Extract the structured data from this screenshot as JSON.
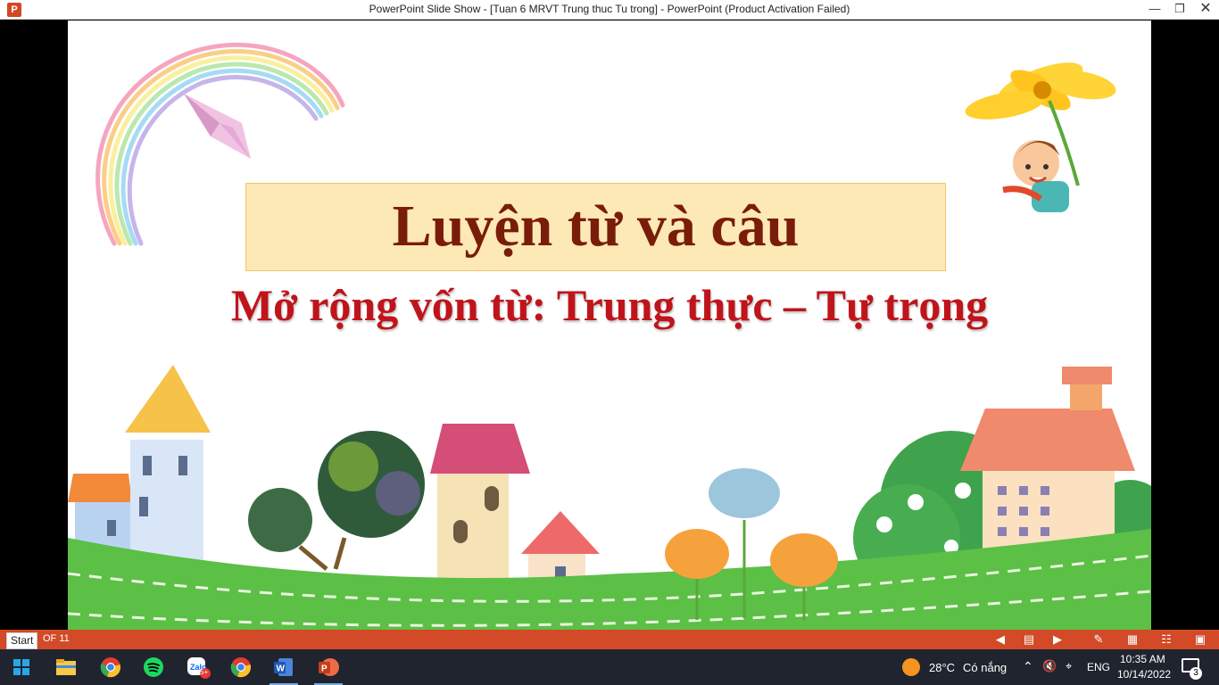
{
  "window": {
    "title": "PowerPoint Slide Show - [Tuan 6 MRVT Trung thuc  Tu trong] - PowerPoint (Product Activation Failed)",
    "app_icon_letter": "P"
  },
  "slide": {
    "title": "Luyện từ và câu",
    "subtitle": "Mở rộng vốn từ: Trung thực – Tự trọng"
  },
  "slideshow_bar": {
    "start_label": "Start",
    "slide_counter": "OF 11"
  },
  "taskbar": {
    "weather_temp": "28°C",
    "weather_text": "Có nắng",
    "language": "ENG",
    "time": "10:35 AM",
    "date": "10/14/2022",
    "notification_count": "3",
    "zalo_badge": "5+",
    "apps": [
      "windows-start",
      "file-explorer",
      "chrome",
      "spotify",
      "zalo",
      "chrome",
      "word",
      "powerpoint"
    ]
  },
  "colors": {
    "accent": "#d24a27",
    "title_color": "#7a1c0a",
    "subtitle_color": "#c0141b",
    "title_box_bg": "#fde9b5",
    "taskbar_bg": "#20242e"
  }
}
